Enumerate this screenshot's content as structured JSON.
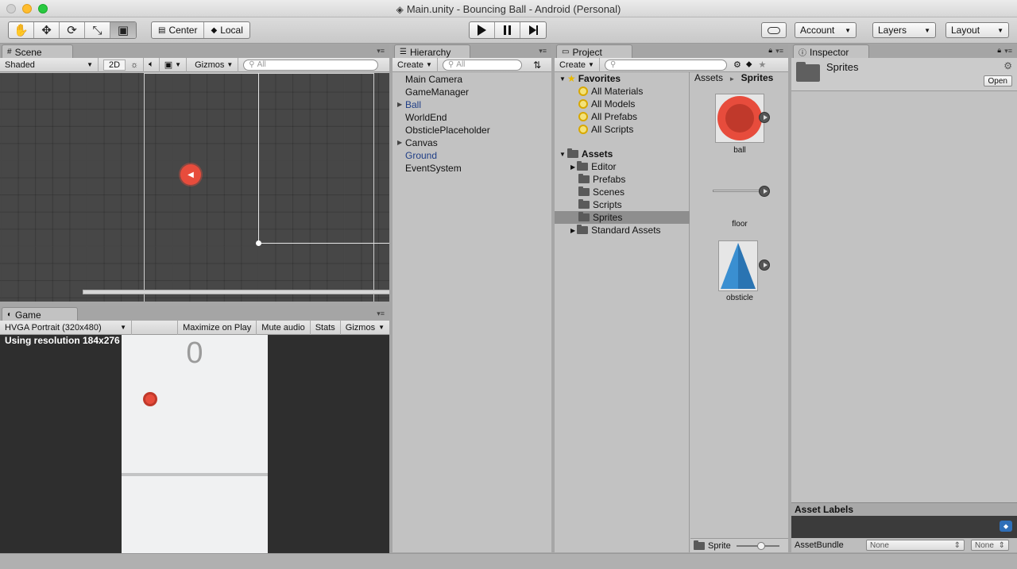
{
  "window": {
    "title": "Main.unity - Bouncing Ball - Android (Personal)"
  },
  "toolbar": {
    "pivot_label": "Center",
    "space_label": "Local",
    "account_label": "Account",
    "layers_label": "Layers",
    "layout_label": "Layout"
  },
  "scene": {
    "tab_label": "Scene",
    "shading_mode": "Shaded",
    "mode_2d_label": "2D",
    "gizmos_label": "Gizmos",
    "search_placeholder": "All"
  },
  "game": {
    "tab_label": "Game",
    "aspect_label": "HVGA Portrait (320x480)",
    "maximize_label": "Maximize on Play",
    "mute_label": "Mute audio",
    "stats_label": "Stats",
    "gizmos_label": "Gizmos",
    "resolution_text": "Using resolution 184x276",
    "score": "0"
  },
  "hierarchy": {
    "tab_label": "Hierarchy",
    "create_label": "Create",
    "search_placeholder": "All",
    "items": [
      {
        "label": "Main Camera"
      },
      {
        "label": "GameManager"
      },
      {
        "label": "Ball"
      },
      {
        "label": "WorldEnd"
      },
      {
        "label": "ObsticlePlaceholder"
      },
      {
        "label": "Canvas"
      },
      {
        "label": "Ground"
      },
      {
        "label": "EventSystem"
      }
    ]
  },
  "project": {
    "tab_label": "Project",
    "create_label": "Create",
    "favorites_label": "Favorites",
    "favorites": [
      "All Materials",
      "All Models",
      "All Prefabs",
      "All Scripts"
    ],
    "assets_label": "Assets",
    "folders": [
      "Editor",
      "Prefabs",
      "Scenes",
      "Scripts",
      "Sprites",
      "Standard Assets"
    ],
    "breadcrumb": {
      "root": "Assets",
      "sep": "►",
      "current": "Sprites"
    },
    "assets": [
      "ball",
      "floor",
      "obsticle"
    ],
    "footer_label": "Sprite"
  },
  "inspector": {
    "tab_label": "Inspector",
    "selected_name": "Sprites",
    "open_label": "Open",
    "asset_labels_title": "Asset Labels",
    "assetbundle_label": "AssetBundle",
    "bundle_value": "None",
    "variant_value": "None"
  },
  "colors": {
    "ball_red": "#e74c3c",
    "ball_inner": "#c0392b",
    "obstacle_blue": "#3a8fd1",
    "link_blue": "#1f3e86"
  }
}
